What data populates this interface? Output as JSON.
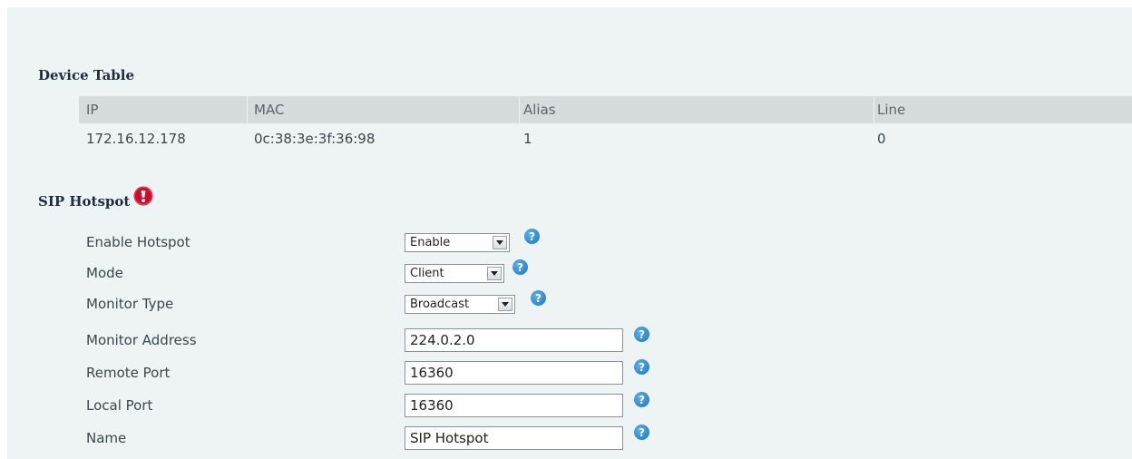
{
  "device_table": {
    "title": "Device Table",
    "headers": [
      "IP",
      "MAC",
      "Alias",
      "Line"
    ],
    "rows": [
      [
        "172.16.12.178",
        "0c:38:3e:3f:36:98",
        "1",
        "0"
      ]
    ]
  },
  "sip_hotspot": {
    "title": "SIP Hotspot",
    "help_glyph": "?",
    "fields": {
      "enable_hotspot": {
        "label": "Enable Hotspot",
        "value": "Enable"
      },
      "mode": {
        "label": "Mode",
        "value": "Client"
      },
      "monitor_type": {
        "label": "Monitor Type",
        "value": "Broadcast"
      },
      "monitor_address": {
        "label": "Monitor Address",
        "value": "224.0.2.0"
      },
      "remote_port": {
        "label": "Remote Port",
        "value": "16360"
      },
      "local_port": {
        "label": "Local Port",
        "value": "16360"
      },
      "name": {
        "label": "Name",
        "value": "SIP Hotspot"
      }
    }
  },
  "icons": {
    "warning": "warning-icon",
    "help": "help-icon",
    "dropdown": "chevron-down-icon"
  },
  "colors": {
    "panel_bg": "#eef3f3",
    "header_bg": "#d6dbdb",
    "help_blue": "#1b76b8",
    "warning_red": "#c8102e",
    "title_text": "#1e2d3f"
  }
}
